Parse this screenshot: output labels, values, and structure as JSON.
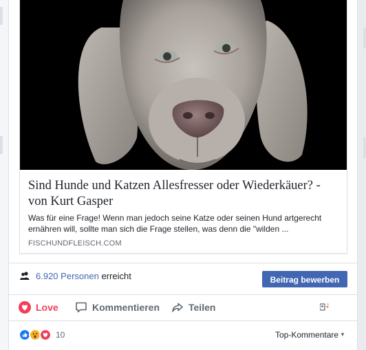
{
  "preview": {
    "image": "dog-photo",
    "title": "Sind Hunde und Katzen Allesfresser oder Wiederkäuer? - von Kurt Gasper",
    "description": "Was für eine Frage! Wenn man jedoch seine Katze oder seinen Hund artgerecht ernähren will, sollte man sich die Frage stellen, was denn die \"wilden ...",
    "domain": "FISCHUNDFLEISCH.COM"
  },
  "reach": {
    "icon": "people-icon",
    "count": "6.920",
    "unit": "Personen",
    "suffix": "erreicht",
    "boost_label": "Beitrag bewerben"
  },
  "actions": {
    "love_label": "Love",
    "comment_label": "Kommentieren",
    "share_label": "Teilen"
  },
  "reactions": {
    "icons": [
      "like-icon",
      "wow-icon",
      "love-icon"
    ],
    "count": "10",
    "sort_label": "Top-Kommentare"
  },
  "colors": {
    "love": "#f33e58",
    "link": "#4267b2",
    "muted": "#606770",
    "like": "#1877f2",
    "wow": "#f7b125"
  }
}
